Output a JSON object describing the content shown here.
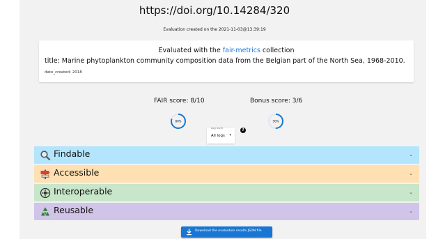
{
  "header": {
    "doi": "https://doi.org/10.14284/320",
    "evaluation_created": "Evaluation created on the 2021-11-03@13:39:19"
  },
  "card": {
    "evaluated_prefix": "Evaluated with the ",
    "collection_link": "fair-metrics",
    "evaluated_suffix": " collection",
    "title_line": "title: Marine phytoplankton community composition data from the Belgian part of the North Sea, 1968-2010.",
    "date_created": "date_created: 2018"
  },
  "scores": {
    "fair_label": "FAIR score: 8/10",
    "fair_percent": 80,
    "fair_percent_text": "80%",
    "bonus_label": "Bonus score: 3/6",
    "bonus_percent": 50,
    "bonus_percent_text": "50%"
  },
  "log_level": {
    "label": "Log level",
    "value": "All logs"
  },
  "sections": [
    {
      "label": "Findable",
      "icon": "magnifier-icon",
      "color": "#b3e5fc"
    },
    {
      "label": "Accessible",
      "icon": "signpost-icon",
      "color": "#ffe0b2"
    },
    {
      "label": "Interoperable",
      "icon": "gear-circle-icon",
      "color": "#c8e6c9"
    },
    {
      "label": "Reusable",
      "icon": "recycle-icon",
      "color": "#d1c4e9"
    }
  ],
  "download": {
    "label": "Download the evaluation results JSON file"
  },
  "colors": {
    "accent": "#1976d2",
    "link": "#1e78d8",
    "page_bg": "#f2f2f2"
  }
}
